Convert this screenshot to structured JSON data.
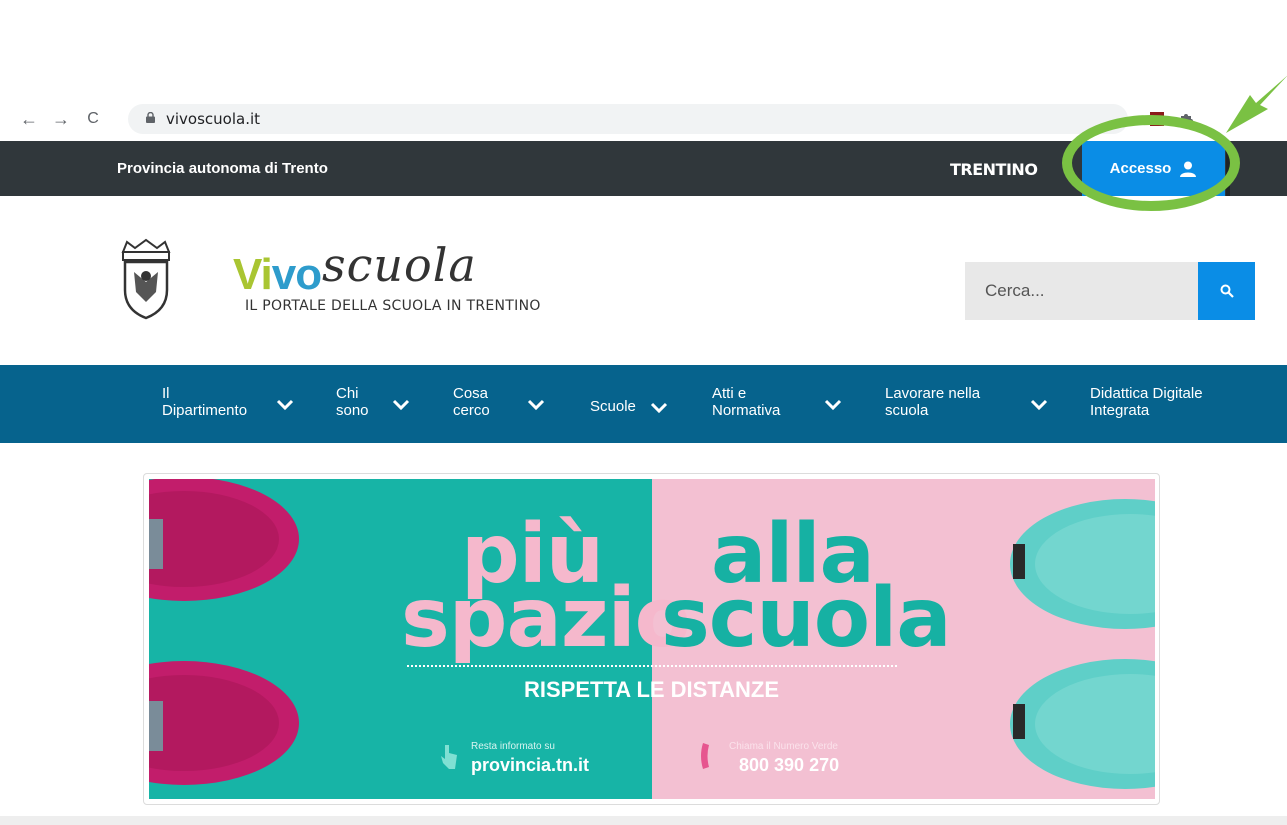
{
  "browser": {
    "back": "←",
    "forward": "→",
    "reload": "C",
    "url": "vivoscuola.it"
  },
  "topbar": {
    "org_name": "Provincia autonoma di Trento",
    "region_logo": "TRENTINO",
    "access_label": "Accesso"
  },
  "header": {
    "logo_vivo_a": "Vi",
    "logo_vivo_b": "vo",
    "logo_scuola": "scuola",
    "tagline": "IL PORTALE DELLA SCUOLA IN TRENTINO",
    "search_placeholder": "Cerca..."
  },
  "nav": {
    "items": [
      {
        "line1": "Il",
        "line2": "Dipartimento"
      },
      {
        "line1": "Chi",
        "line2": "sono"
      },
      {
        "line1": "Cosa",
        "line2": "cerco"
      },
      {
        "line1": "Scuole",
        "line2": ""
      },
      {
        "line1": "Atti e",
        "line2": "Normativa"
      },
      {
        "line1": "Lavorare nella",
        "line2": "scuola"
      },
      {
        "line1": "Didattica Digitale",
        "line2": "Integrata"
      }
    ]
  },
  "banner": {
    "left_top": "più",
    "left_bottom": "spazio",
    "right_top": "alla",
    "right_bottom": "scuola",
    "distance": "RISPETTA LE DISTANZE",
    "info_left_small": "Resta informato su",
    "info_left_big": "provincia.tn.it",
    "info_right_small": "Chiama il Numero Verde",
    "info_right_big": "800 390 270"
  },
  "icons": {
    "lock": "lock-icon",
    "user": "user-icon",
    "search": "search-icon",
    "chevron": "chevron-down-icon"
  },
  "colors": {
    "topbar": "#30373b",
    "accent_blue": "#0a8de6",
    "nav_blue": "#06638d",
    "highlight_green": "#7ac143",
    "banner_teal": "#17b4a6",
    "banner_pink": "#f3c0d2"
  }
}
